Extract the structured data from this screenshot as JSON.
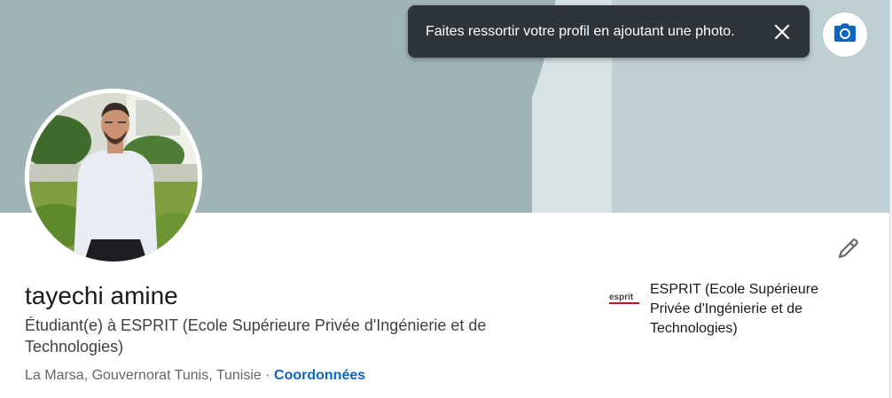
{
  "toast": {
    "message": "Faites ressortir votre profil en ajoutant une photo."
  },
  "profile": {
    "name": "tayechi amine",
    "headline": "Étudiant(e) à ESPRIT (Ecole Supérieure Privée d'Ingénierie et de Technologies)",
    "location": "La Marsa, Gouvernorat Tunis, Tunisie",
    "separator": "·",
    "contact_link": "Coordonnées"
  },
  "education": {
    "logo_text": "esprit",
    "school": "ESPRIT (Ecole Supérieure Privée d'Ingénierie et de Technologies)"
  },
  "icons": {
    "toast_close": "close-icon",
    "banner_camera": "camera-icon",
    "edit_intro": "pencil-icon"
  },
  "colors": {
    "link": "#0a66c2",
    "toast_bg": "#2d353b",
    "banner": "#a0b4b7"
  }
}
